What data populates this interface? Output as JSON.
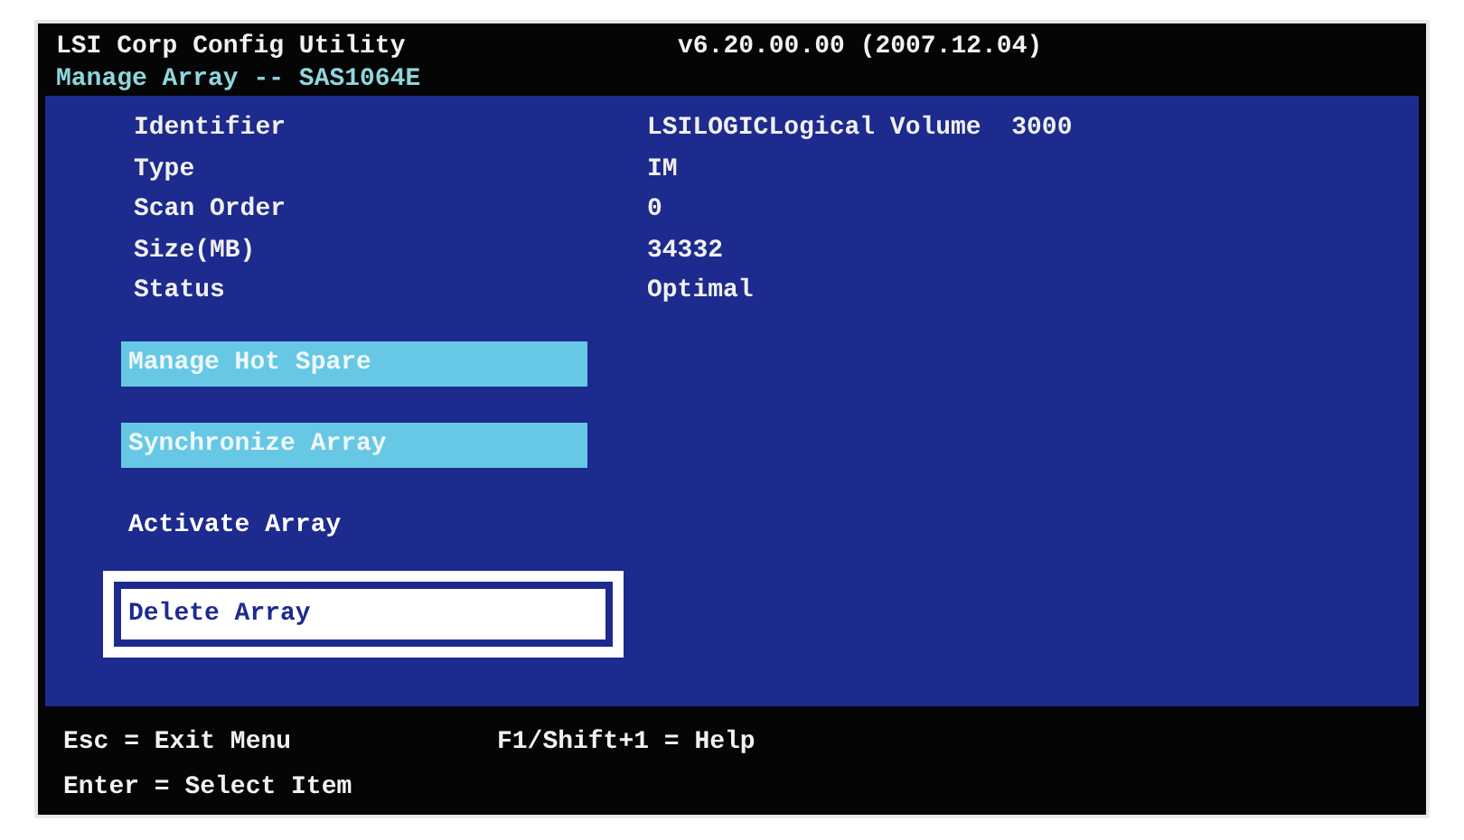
{
  "header": {
    "title": "LSI Corp Config Utility",
    "version": "v6.20.00.00 (2007.12.04)",
    "subtitle": "Manage Array -- SAS1064E"
  },
  "properties": [
    {
      "label": "Identifier",
      "value": "LSILOGICLogical Volume  3000"
    },
    {
      "label": "Type",
      "value": "IM"
    },
    {
      "label": "Scan Order",
      "value": "0"
    },
    {
      "label": "Size(MB)",
      "value": "34332"
    },
    {
      "label": "Status",
      "value": "Optimal"
    }
  ],
  "menu": [
    {
      "label": "Manage Hot Spare",
      "kind": "bar",
      "selected": false
    },
    {
      "label": "Synchronize Array",
      "kind": "bar",
      "selected": false
    },
    {
      "label": "Activate Array",
      "kind": "plain",
      "selected": false
    },
    {
      "label": "Delete Array",
      "kind": "plain",
      "selected": true
    }
  ],
  "footer": {
    "left": [
      "Esc = Exit Menu",
      "Enter = Select Item"
    ],
    "right": [
      "F1/Shift+1 = Help"
    ]
  }
}
